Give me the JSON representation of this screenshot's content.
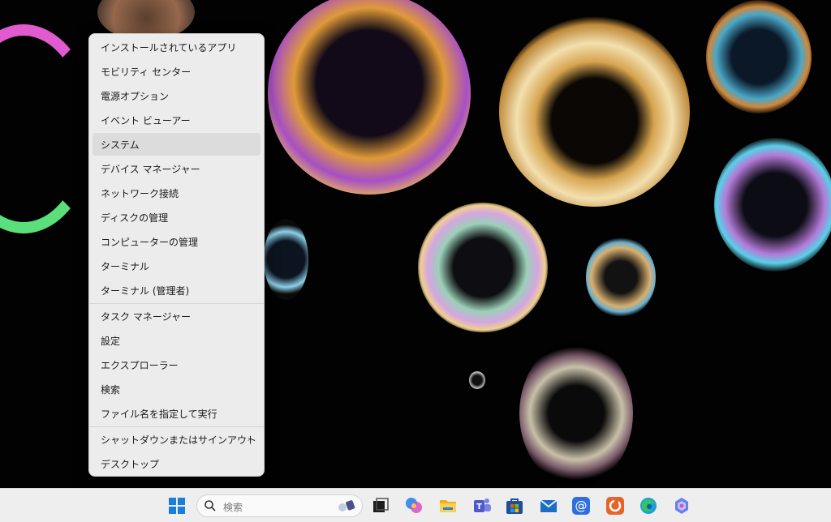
{
  "context_menu": {
    "items": [
      {
        "label": "インストールされているアプリ"
      },
      {
        "label": "モビリティ センター"
      },
      {
        "label": "電源オプション"
      },
      {
        "label": "イベント ビューアー"
      },
      {
        "label": "システム"
      },
      {
        "label": "デバイス マネージャー"
      },
      {
        "label": "ネットワーク接続"
      },
      {
        "label": "ディスクの管理"
      },
      {
        "label": "コンピューターの管理"
      },
      {
        "label": "ターミナル"
      },
      {
        "label": "ターミナル (管理者)"
      },
      {
        "label": "タスク マネージャー"
      },
      {
        "label": "設定"
      },
      {
        "label": "エクスプローラー"
      },
      {
        "label": "検索"
      },
      {
        "label": "ファイル名を指定して実行"
      },
      {
        "label": "シャットダウンまたはサインアウト"
      },
      {
        "label": "デスクトップ"
      }
    ],
    "submenu_glyph": "›"
  },
  "taskbar": {
    "search_placeholder": "検索",
    "icons": [
      "start-icon",
      "search-icon",
      "task-view-icon",
      "copilot-icon",
      "file-explorer-icon",
      "teams-icon",
      "store-icon",
      "mail-icon",
      "email-icon",
      "office-icon",
      "edge-icon",
      "copilot-app-icon"
    ]
  },
  "colors": {
    "menu_bg": "#ececec",
    "menu_hover": "#dcdcdc",
    "taskbar_bg": "#eeeeee",
    "desktop_bg": "#020202"
  }
}
